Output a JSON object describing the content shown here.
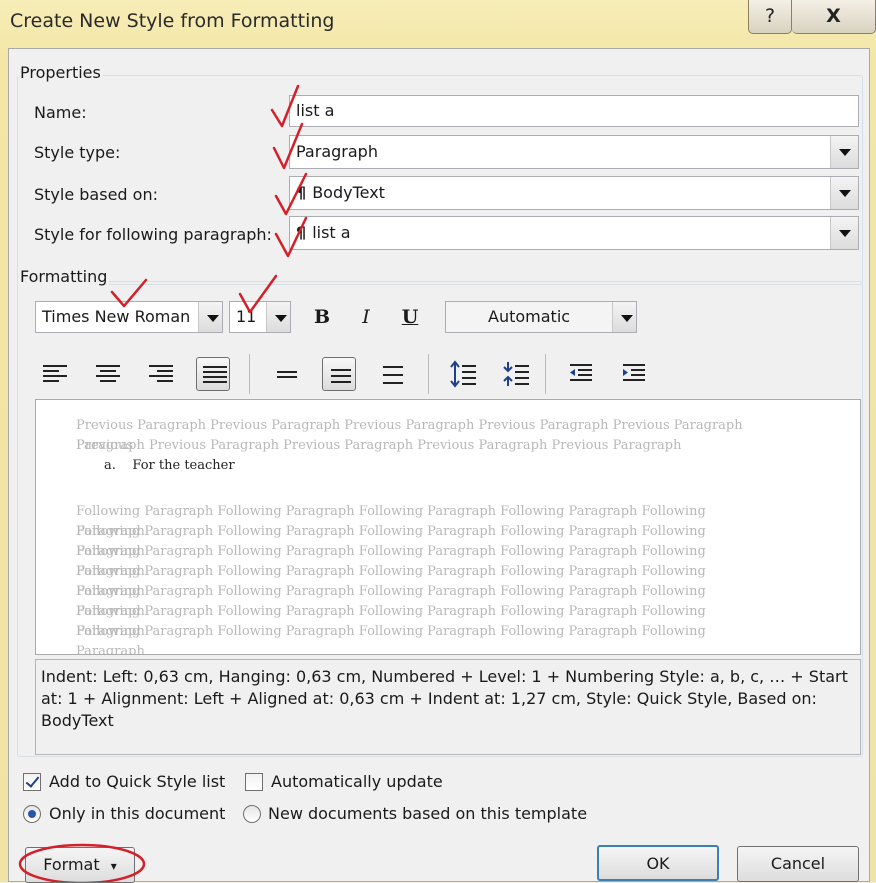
{
  "window": {
    "title": "Create New Style from Formatting",
    "help_label": "?",
    "close_label": "X"
  },
  "properties": {
    "group_label": "Properties",
    "name_label": "Name:",
    "name_value": "list a",
    "style_type_label": "Style type:",
    "style_type_value": "Paragraph",
    "based_on_label": "Style based on:",
    "based_on_value": "BodyText",
    "following_label": "Style for following paragraph:",
    "following_value": "list a",
    "paragraph_mark": "¶"
  },
  "formatting": {
    "group_label": "Formatting",
    "font_name": "Times New Roman",
    "font_size": "11",
    "bold": "B",
    "italic": "I",
    "underline": "U",
    "color": "Automatic"
  },
  "preview": {
    "previous_line1": "Previous Paragraph Previous Paragraph Previous Paragraph Previous Paragraph Previous Paragraph Previous",
    "previous_line2": "Paragraph Previous Paragraph Previous Paragraph Previous Paragraph Previous Paragraph",
    "sample_marker": "a.",
    "sample_text": "For the teacher",
    "following_line": "Following Paragraph Following Paragraph Following Paragraph Following Paragraph Following Paragraph"
  },
  "description": "Indent: Left:  0,63 cm, Hanging:  0,63 cm, Numbered + Level: 1 + Numbering Style: a, b, c, … + Start at: 1 + Alignment: Left + Aligned at:  0,63 cm + Indent at:  1,27 cm, Style: Quick Style, Based on: BodyText",
  "options": {
    "add_to_quick_style": "Add to Quick Style list",
    "add_to_quick_style_checked": true,
    "auto_update": "Automatically update",
    "auto_update_checked": false,
    "only_this_document": "Only in this document",
    "new_documents": "New documents based on this template",
    "selected_scope": "only_this_document"
  },
  "buttons": {
    "format": "Format",
    "format_arrow": "▾",
    "ok": "OK",
    "cancel": "Cancel"
  },
  "colors": {
    "annotation": "#d4202a",
    "titlebar": "#f3e6a6",
    "dialog_bg": "#f0f0f0"
  }
}
